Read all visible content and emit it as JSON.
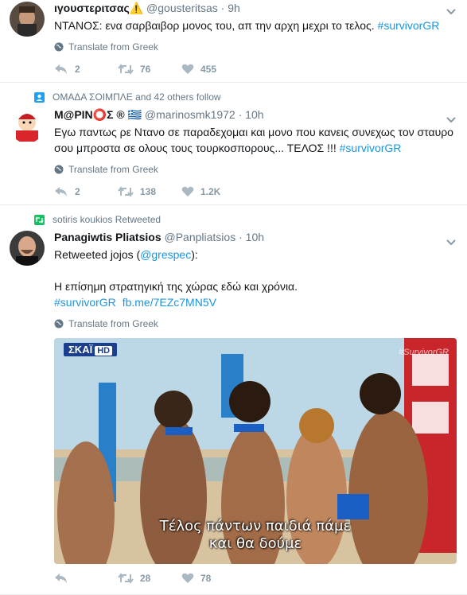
{
  "tweets": [
    {
      "fullname": "ιγουστεριτσας⚠️",
      "handle": "@gousteritsas",
      "sep": "·",
      "time": "9h",
      "text": "ΝΤΑΝΟΣ: ενα σαρβαιβορ μονος του, απ την αρχη μεχρι το τελος.",
      "hashtag": "#survivorGR",
      "translate": "Translate from Greek",
      "replies": "2",
      "retweets": "76",
      "likes": "455"
    },
    {
      "context": "ΟΜΑΔΑ ΣΟΙΜΠΛΕ and 42 others follow",
      "fullname": "Μ@ΡΙΝ⭕️Σ ® 🇬🇷",
      "handle": "@marinosmk1972",
      "sep": "·",
      "time": "10h",
      "text_line1": "Εγω παντως ρε Ντανο σε παραδεχομαι και μονο που κανεις συνεχως τον σταυρο",
      "text_line2": "σου μπροστα σε ολους τους τουρκοσπορους... ΤΕΛΟΣ !!!",
      "hashtag": "#survivorGR",
      "translate": "Translate from Greek",
      "replies": "2",
      "retweets": "138",
      "likes": "1.2K"
    },
    {
      "context": "sotiris koukios Retweeted",
      "fullname": "Panagiwtis Pliatsios",
      "handle": "@Panpliatsios",
      "sep": "·",
      "time": "10h",
      "rt_prefix": "Retweeted jojos (",
      "rt_mention": "@grespec",
      "rt_suffix": "):",
      "text": "Η επίσημη στρατηγική της χώρας εδώ και χρόνια.",
      "hashtag": "#survivorGR",
      "link": "fb.me/7EZc7MN5V",
      "translate": "Translate from Greek",
      "media_logo": "ΣΚΑΪ",
      "media_logo_hd": "HD",
      "media_watermark": "#SurvivorGR",
      "subtitle_line1": "Τέλος πάντων παιδιά πάμε",
      "subtitle_line2": "και θα δούμε",
      "replies": "",
      "retweets": "28",
      "likes": "78"
    }
  ],
  "colors": {
    "link": "#1b95e0",
    "muted": "#657786",
    "icon": "#aab8c2",
    "retweet_green": "#17bf63"
  }
}
